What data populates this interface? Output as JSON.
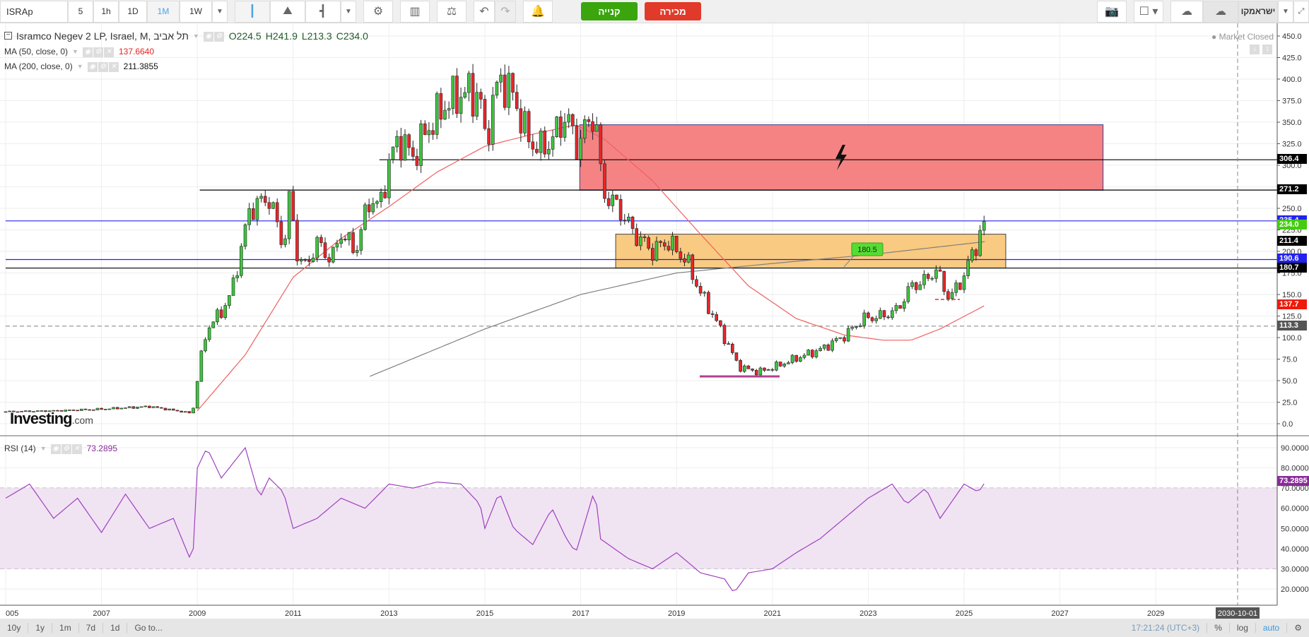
{
  "toolbar": {
    "symbol": "ISRAp",
    "intervals": [
      "5",
      "1h",
      "1D",
      "1M",
      "1W"
    ],
    "active_interval": "1M",
    "buy_label": "קנייה",
    "sell_label": "מכירה",
    "instrument_menu": "ישראמקו"
  },
  "legend": {
    "title": "Isramco Negev 2 LP, Israel, M, תל אביב",
    "open": "O224.5",
    "high": "H241.9",
    "low": "L213.3",
    "close": "C234.0",
    "ma50_label": "MA (50, close, 0)",
    "ma50_value": "137.6640",
    "ma200_label": "MA (200, close, 0)",
    "ma200_value": "211.3855",
    "rsi_label": "RSI (14)",
    "rsi_value": "73.2895",
    "market_status": "Market Closed"
  },
  "logo": {
    "text": "Investing",
    "suffix": ".com"
  },
  "price_axis": {
    "ticks": [
      450,
      425,
      400,
      375,
      350,
      325,
      300,
      275,
      250,
      225,
      200,
      175,
      150,
      125,
      100,
      75,
      50,
      25,
      0
    ],
    "labels": [
      {
        "text": "306.4",
        "value": 306.4,
        "color": "#000000"
      },
      {
        "text": "271.2",
        "value": 271.2,
        "color": "#000000"
      },
      {
        "text": "235.4",
        "value": 235.4,
        "color": "#2222ee"
      },
      {
        "text": "234.0",
        "value": 230.5,
        "color": "#44cc11"
      },
      {
        "text": "211.4",
        "value": 211.4,
        "color": "#000000"
      },
      {
        "text": "190.6",
        "value": 190.6,
        "color": "#2222ee"
      },
      {
        "text": "180.7",
        "value": 180.7,
        "color": "#000000"
      },
      {
        "text": "137.7",
        "value": 137.7,
        "color": "#ee1a0a"
      },
      {
        "text": "113.3",
        "value": 113.3,
        "color": "#555555"
      }
    ]
  },
  "rsi_axis": {
    "ticks": [
      "90.0000",
      "80.0000",
      "70.0000",
      "60.0000",
      "50.0000",
      "40.0000",
      "30.0000",
      "20.0000"
    ],
    "current": "73.2895"
  },
  "time_axis": {
    "labels": [
      "005",
      "2007",
      "2009",
      "2011",
      "2013",
      "2015",
      "2017",
      "2019",
      "2021",
      "2023",
      "2025",
      "2027",
      "2029"
    ],
    "cursor_date": "2030-10-01"
  },
  "drawings": {
    "callout_label": "180.5"
  },
  "bottombar": {
    "ranges": [
      "10y",
      "1y",
      "1m",
      "7d",
      "1d",
      "Go to..."
    ],
    "clock": "17:21:24 (UTC+3)",
    "percent": "%",
    "log": "log",
    "auto": "auto"
  },
  "colors": {
    "up": "#3fc43f",
    "down": "#e8262a",
    "ma50": "#f06060",
    "ma200": "#808080",
    "rsi": "#a040c0"
  },
  "chart_data": {
    "type": "candlestick",
    "x_unit": "year",
    "ylim": [
      0,
      450
    ],
    "price_keypoints": [
      [
        2005,
        14
      ],
      [
        2006,
        15
      ],
      [
        2007,
        17
      ],
      [
        2008,
        20
      ],
      [
        2008.9,
        12
      ],
      [
        2009.05,
        70
      ],
      [
        2009.2,
        110
      ],
      [
        2009.5,
        130
      ],
      [
        2009.7,
        150
      ],
      [
        2010.1,
        250
      ],
      [
        2010.5,
        262
      ],
      [
        2010.8,
        205
      ],
      [
        2010.95,
        272
      ],
      [
        2011.05,
        200
      ],
      [
        2011.25,
        182
      ],
      [
        2011.5,
        210
      ],
      [
        2011.8,
        190
      ],
      [
        2012.0,
        222
      ],
      [
        2012.3,
        200
      ],
      [
        2012.6,
        262
      ],
      [
        2012.8,
        250
      ],
      [
        2013.0,
        302
      ],
      [
        2013.2,
        332
      ],
      [
        2013.5,
        310
      ],
      [
        2013.8,
        342
      ],
      [
        2014.2,
        372
      ],
      [
        2014.6,
        385
      ],
      [
        2014.9,
        380
      ],
      [
        2015.0,
        330
      ],
      [
        2015.3,
        402
      ],
      [
        2015.6,
        380
      ],
      [
        2015.9,
        330
      ],
      [
        2016.2,
        318
      ],
      [
        2016.5,
        338
      ],
      [
        2016.7,
        360
      ],
      [
        2016.9,
        322
      ],
      [
        2017.3,
        362
      ],
      [
        2017.45,
        270
      ],
      [
        2017.8,
        250
      ],
      [
        2018.1,
        222
      ],
      [
        2018.5,
        200
      ],
      [
        2018.8,
        212
      ],
      [
        2019.2,
        190
      ],
      [
        2019.5,
        152
      ],
      [
        2019.8,
        122
      ],
      [
        2020.0,
        100
      ],
      [
        2020.3,
        66
      ],
      [
        2020.7,
        60
      ],
      [
        2021.0,
        65
      ],
      [
        2021.5,
        76
      ],
      [
        2022.0,
        86
      ],
      [
        2022.5,
        102
      ],
      [
        2022.9,
        122
      ],
      [
        2023.3,
        125
      ],
      [
        2023.6,
        132
      ],
      [
        2023.9,
        160
      ],
      [
        2024.2,
        166
      ],
      [
        2024.4,
        180
      ],
      [
        2024.7,
        145
      ],
      [
        2025.0,
        172
      ],
      [
        2025.2,
        202
      ],
      [
        2025.45,
        234
      ]
    ],
    "ma50_keypoints": [
      [
        2009.0,
        15
      ],
      [
        2010,
        80
      ],
      [
        2011,
        170
      ],
      [
        2012,
        215
      ],
      [
        2013,
        252
      ],
      [
        2014,
        292
      ],
      [
        2015,
        322
      ],
      [
        2016,
        336
      ],
      [
        2016.9,
        347
      ],
      [
        2017.5,
        330
      ],
      [
        2018.5,
        282
      ],
      [
        2019.5,
        220
      ],
      [
        2020.5,
        160
      ],
      [
        2021.5,
        122
      ],
      [
        2022.5,
        103
      ],
      [
        2023.3,
        97
      ],
      [
        2023.9,
        97
      ],
      [
        2024.5,
        110
      ],
      [
        2025.45,
        137.7
      ]
    ],
    "ma200_keypoints": [
      [
        2012.6,
        55
      ],
      [
        2015,
        110
      ],
      [
        2017,
        150
      ],
      [
        2019,
        175
      ],
      [
        2021,
        186
      ],
      [
        2023,
        196
      ],
      [
        2025.45,
        211.4
      ]
    ],
    "rsi_keypoints": [
      [
        2005,
        65
      ],
      [
        2005.5,
        72
      ],
      [
        2006,
        55
      ],
      [
        2006.5,
        65
      ],
      [
        2007,
        48
      ],
      [
        2007.5,
        67
      ],
      [
        2008,
        50
      ],
      [
        2008.5,
        55
      ],
      [
        2008.9,
        32
      ],
      [
        2009.0,
        80
      ],
      [
        2009.2,
        90
      ],
      [
        2009.5,
        75
      ],
      [
        2010,
        90
      ],
      [
        2010.3,
        65
      ],
      [
        2010.5,
        75
      ],
      [
        2010.8,
        68
      ],
      [
        2011,
        50
      ],
      [
        2011.5,
        55
      ],
      [
        2012,
        65
      ],
      [
        2012.5,
        60
      ],
      [
        2013,
        72
      ],
      [
        2013.5,
        70
      ],
      [
        2014,
        73
      ],
      [
        2014.5,
        72
      ],
      [
        2014.9,
        62
      ],
      [
        2015.0,
        50
      ],
      [
        2015.3,
        68
      ],
      [
        2015.6,
        50
      ],
      [
        2016,
        42
      ],
      [
        2016.4,
        60
      ],
      [
        2016.7,
        45
      ],
      [
        2016.9,
        38
      ],
      [
        2017.3,
        70
      ],
      [
        2017.4,
        45
      ],
      [
        2018,
        35
      ],
      [
        2018.5,
        30
      ],
      [
        2019,
        38
      ],
      [
        2019.5,
        28
      ],
      [
        2020,
        25
      ],
      [
        2020.2,
        18
      ],
      [
        2020.5,
        28
      ],
      [
        2021,
        30
      ],
      [
        2021.5,
        38
      ],
      [
        2022,
        45
      ],
      [
        2022.5,
        55
      ],
      [
        2023,
        65
      ],
      [
        2023.5,
        72
      ],
      [
        2023.8,
        62
      ],
      [
        2024.2,
        70
      ],
      [
        2024.5,
        55
      ],
      [
        2025,
        72
      ],
      [
        2025.3,
        68
      ],
      [
        2025.45,
        73.29
      ]
    ],
    "zones": [
      {
        "name": "resistance",
        "from": 2016.98,
        "to": 2027.9,
        "top": 347,
        "bottom": 271,
        "color": "#f47c7c"
      },
      {
        "name": "support",
        "from": 2017.73,
        "to": 2025.87,
        "top": 220,
        "bottom": 180.7,
        "color": "#f9c77a"
      }
    ],
    "hlines": [
      {
        "value": 306.4,
        "from": 2012.8,
        "color": "#000000"
      },
      {
        "value": 271.2,
        "from": 2009.05,
        "color": "#000000"
      },
      {
        "value": 235.4,
        "from": 2005,
        "color": "#2222ee"
      },
      {
        "value": 190.6,
        "from": 2005,
        "color": "#2222ee"
      },
      {
        "value": 180.7,
        "from": 2005,
        "color": "#000000"
      },
      {
        "value": 113.3,
        "from": 2005,
        "color": "#999999",
        "dashed": true
      }
    ],
    "rsi_bands": [
      30,
      70
    ]
  }
}
